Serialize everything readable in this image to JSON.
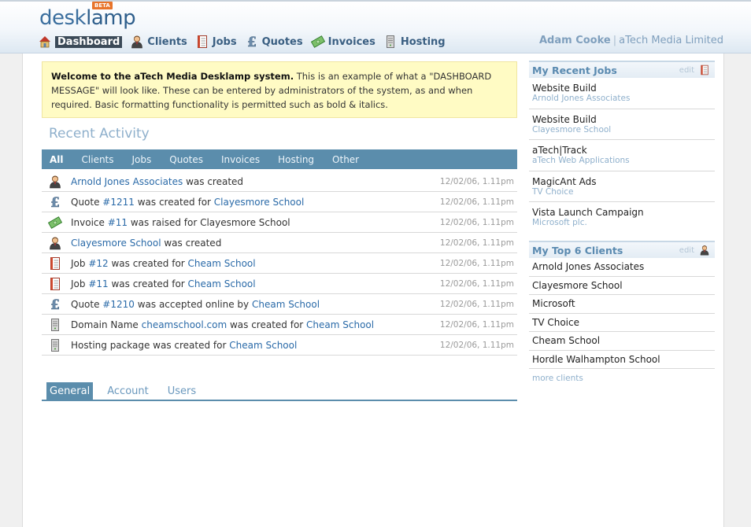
{
  "app": {
    "logo_text_1": "desk",
    "logo_text_2": "lamp",
    "beta": "BETA"
  },
  "nav": {
    "items": [
      {
        "label": "Dashboard",
        "icon": "house-icon"
      },
      {
        "label": "Clients",
        "icon": "person-icon"
      },
      {
        "label": "Jobs",
        "icon": "notepad-icon"
      },
      {
        "label": "Quotes",
        "icon": "pound-icon"
      },
      {
        "label": "Invoices",
        "icon": "banknote-icon"
      },
      {
        "label": "Hosting",
        "icon": "server-icon"
      }
    ]
  },
  "user": {
    "name": "Adam Cooke",
    "separator": "|",
    "company": "aTech Media Limited"
  },
  "welcome": {
    "bold": "Welcome to the aTech Media Desklamp system.",
    "text": " This is an example of what a \"DASHBOARD MESSAGE\" will look like. These can be entered by administrators of the system, as and when required. Basic formatting functionality is permitted such as bold & italics."
  },
  "recent_activity": {
    "title": "Recent Activity",
    "filters": [
      "All",
      "Clients",
      "Jobs",
      "Quotes",
      "Invoices",
      "Hosting",
      "Other"
    ],
    "rows": [
      {
        "icon": "person-icon",
        "pre": "",
        "link1": "Arnold Jones Associates",
        "mid": " was created",
        "link2": "",
        "post": "",
        "time": "12/02/06, 1.11pm"
      },
      {
        "icon": "pound-icon",
        "pre": "Quote ",
        "link1": "#1211",
        "mid": " was created for ",
        "link2": "Clayesmore School",
        "post": "",
        "time": "12/02/06, 1.11pm"
      },
      {
        "icon": "banknote-icon",
        "pre": "Invoice ",
        "link1": "#11",
        "mid": " was raised for Clayesmore School",
        "link2": "",
        "post": "",
        "time": "12/02/06, 1.11pm"
      },
      {
        "icon": "person-icon",
        "pre": "",
        "link1": "Clayesmore School",
        "mid": " was created",
        "link2": "",
        "post": "",
        "time": "12/02/06, 1.11pm"
      },
      {
        "icon": "notepad-icon",
        "pre": "Job ",
        "link1": "#12",
        "mid": " was created for ",
        "link2": "Cheam School",
        "post": "",
        "time": "12/02/06, 1.11pm"
      },
      {
        "icon": "notepad-icon",
        "pre": "Job ",
        "link1": "#11",
        "mid": " was created for ",
        "link2": "Cheam School",
        "post": "",
        "time": "12/02/06, 1.11pm"
      },
      {
        "icon": "pound-icon",
        "pre": "Quote ",
        "link1": "#1210",
        "mid": " was accepted online by ",
        "link2": "Cheam School",
        "post": "",
        "time": "12/02/06, 1.11pm"
      },
      {
        "icon": "server-icon",
        "pre": "Domain Name ",
        "link1": "cheamschool.com",
        "mid": " was created for ",
        "link2": "Cheam School",
        "post": "",
        "time": "12/02/06, 1.11pm"
      },
      {
        "icon": "server-icon",
        "pre": "Hosting package was created for ",
        "link1": "Cheam School",
        "mid": "",
        "link2": "",
        "post": "",
        "time": "12/02/06, 1.11pm"
      }
    ]
  },
  "tabs": [
    "General",
    "Account",
    "Users"
  ],
  "recent_jobs": {
    "title": "My Recent Jobs",
    "edit": "edit",
    "items": [
      {
        "title": "Website Build",
        "client": "Arnold Jones Associates"
      },
      {
        "title": "Website Build",
        "client": "Clayesmore School"
      },
      {
        "title": "aTech|Track",
        "client": "aTech Web Applications"
      },
      {
        "title": "MagicAnt Ads",
        "client": "TV Choice"
      },
      {
        "title": "Vista Launch Campaign",
        "client": "Microsoft plc."
      }
    ]
  },
  "top_clients": {
    "title": "My Top 6 Clients",
    "edit": "edit",
    "items": [
      "Arnold Jones Associates",
      "Clayesmore School",
      "Microsoft",
      "TV Choice",
      "Cheam School",
      "Hordle Walhampton School"
    ],
    "more": "more clients"
  }
}
